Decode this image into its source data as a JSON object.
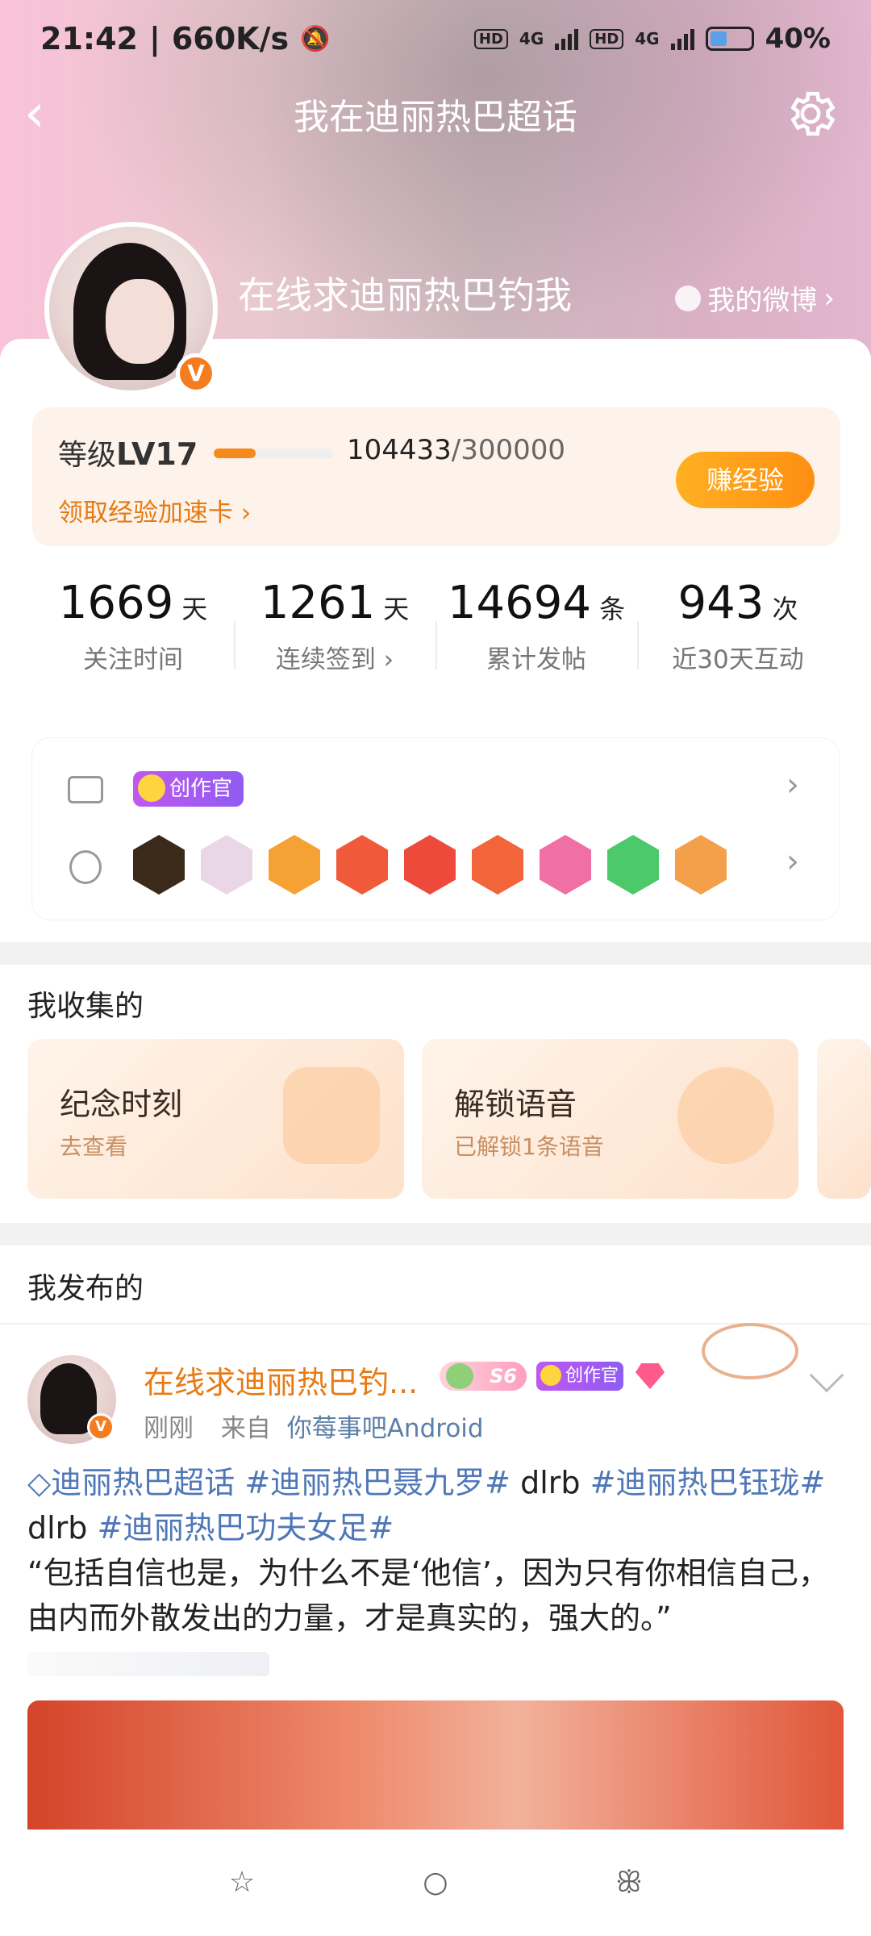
{
  "status_bar": {
    "time": "21:42",
    "speed": "660K/s",
    "network_1": "4G",
    "network_2": "4G",
    "battery": "40%"
  },
  "nav": {
    "title": "我在迪丽热巴超话"
  },
  "profile": {
    "name": "在线求迪丽热巴钓我",
    "my_weibo": "我的微博"
  },
  "level": {
    "label_prefix": "等级",
    "level": "LV17",
    "current": "104433",
    "total": "/300000",
    "progress_percent": 35,
    "accelerate_link": "领取经验加速卡 ›",
    "earn_button": "赚经验"
  },
  "stats": [
    {
      "value": "1669",
      "unit": "天",
      "label": "关注时间"
    },
    {
      "value": "1261",
      "unit": "天",
      "label": "连续签到 ›"
    },
    {
      "value": "14694",
      "unit": "条",
      "label": "累计发帖"
    },
    {
      "value": "943",
      "unit": "次",
      "label": "近30天互动"
    }
  ],
  "badges": {
    "creator_tag": "创作官",
    "medal_colors": [
      "#3b2a1a",
      "#e9d6e7",
      "#f5a133",
      "#f05a3a",
      "#ee4a3c",
      "#f2643a",
      "#f06fa4",
      "#4cc96a",
      "#f4a04a"
    ]
  },
  "collected": {
    "title": "我收集的",
    "items": [
      {
        "title": "纪念时刻",
        "sub": "去查看"
      },
      {
        "title": "解锁语音",
        "sub": "已解锁1条语音"
      }
    ]
  },
  "published": {
    "title": "我发布的"
  },
  "post": {
    "author": "在线求迪丽热巴钓...",
    "level_tag": "S6",
    "creator_tag": "创作官",
    "time": "刚刚",
    "from_label": "来自",
    "source": "你莓事吧Android",
    "tag_1": "迪丽热巴超话",
    "tag_2": "#迪丽热巴聂九罗#",
    "text_1": "dlrb",
    "tag_3": "#迪丽热巴钰珑#",
    "text_2": "dlrb",
    "tag_4": "#迪丽热巴功夫女足#",
    "quote": "“包括自信也是，为什么不是‘他信’，因为只有你相信自己，由内而外散发出的力量，才是真实的，强大的。”"
  },
  "bottom_bar": {
    "icons": [
      "star-icon",
      "apple-icon",
      "cherry-icon"
    ]
  }
}
